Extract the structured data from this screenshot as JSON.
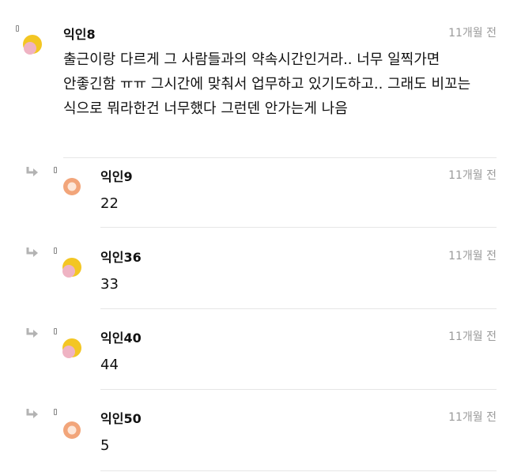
{
  "colors": {
    "avatar_yellow": "#f3c623",
    "avatar_pink": "#efb3c3",
    "avatar_orange": "#f2a57a",
    "timestamp": "#9a9a9a",
    "divider": "#e6e6e6",
    "reply_arrow": "#b3b3b3"
  },
  "comments": [
    {
      "author": "익인8",
      "time": "11개월 전",
      "avatar": "yellow-pink",
      "text": "출근이랑 다르게 그 사람들과의 약속시간인거라.. 너무 일찍가면 안좋긴함 ㅠㅠ 그시간에 맞춰서 업무하고 있기도하고.. 그래도 비꼬는 식으로 뭐라한건 너무했다 그런덴 안가는게 나음"
    }
  ],
  "replies": [
    {
      "author": "익인9",
      "time": "11개월 전",
      "avatar": "orange-ring",
      "text": "22"
    },
    {
      "author": "익인36",
      "time": "11개월 전",
      "avatar": "yellow-pink",
      "text": "33"
    },
    {
      "author": "익인40",
      "time": "11개월 전",
      "avatar": "yellow-pink",
      "text": "44"
    },
    {
      "author": "익인50",
      "time": "11개월 전",
      "avatar": "orange-ring",
      "text": "5"
    }
  ]
}
